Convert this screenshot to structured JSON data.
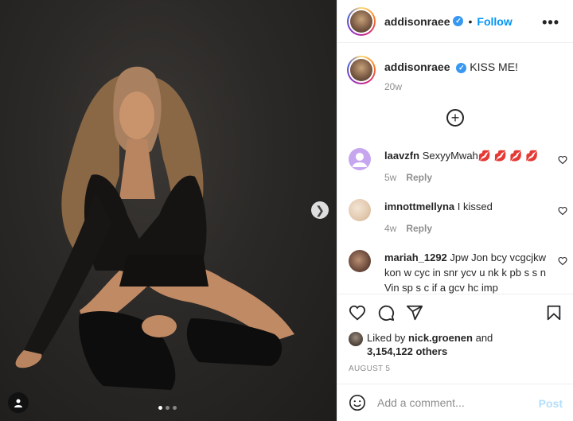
{
  "post": {
    "username": "addisonraee",
    "follow_label": "Follow",
    "separator": "•",
    "more_label": "•••",
    "caption_text": "KISS ME!",
    "caption_time": "20w"
  },
  "comments": [
    {
      "username": "laavzfn",
      "text": "SexyyMwah💋 💋 💋 💋",
      "time": "5w",
      "reply": "Reply"
    },
    {
      "username": "imnottmellyna",
      "text": "I kissed",
      "time": "4w",
      "reply": "Reply"
    },
    {
      "username": "mariah_1292",
      "text": "Jpw Jon bcy vcgcjkw kon w cyc in snr ycv u nk k pb s s n Vin sp s c if a gcv hc imp"
    }
  ],
  "likes": {
    "prefix": "Liked by",
    "user": "nick.groenen",
    "conj": "and",
    "count": "3,154,122 others"
  },
  "date": "AUGUST 5",
  "add_comment": {
    "placeholder": "Add a comment...",
    "post_label": "Post"
  },
  "carousel": {
    "count": 3,
    "active": 1
  },
  "colors": {
    "follow_blue": "#0095f6",
    "verified_blue": "#3897f0",
    "post_disabled": "#b2dffc",
    "muted_text": "#8e8e8e"
  },
  "icons": [
    "chevron-right-icon",
    "user-tag-icon",
    "plus-circle-icon",
    "heart-icon",
    "comment-icon",
    "share-icon",
    "bookmark-icon",
    "emoji-icon",
    "verified-icon"
  ]
}
